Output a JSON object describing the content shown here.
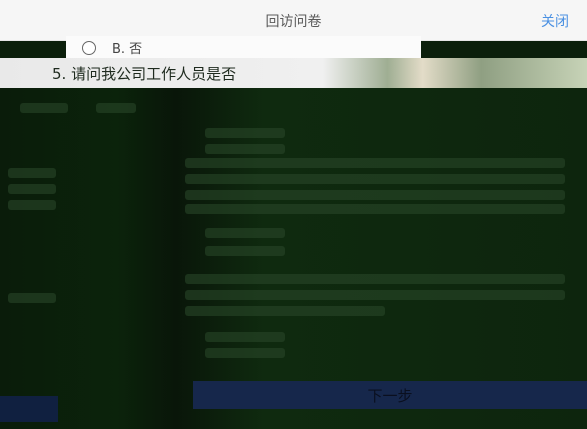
{
  "header": {
    "title": "回访问卷",
    "close_label": "关闭"
  },
  "option_b": {
    "label": "B. 否"
  },
  "question5": {
    "text": "5. 请问我公司工作人员是否"
  },
  "footer": {
    "next_label": "下一步"
  }
}
